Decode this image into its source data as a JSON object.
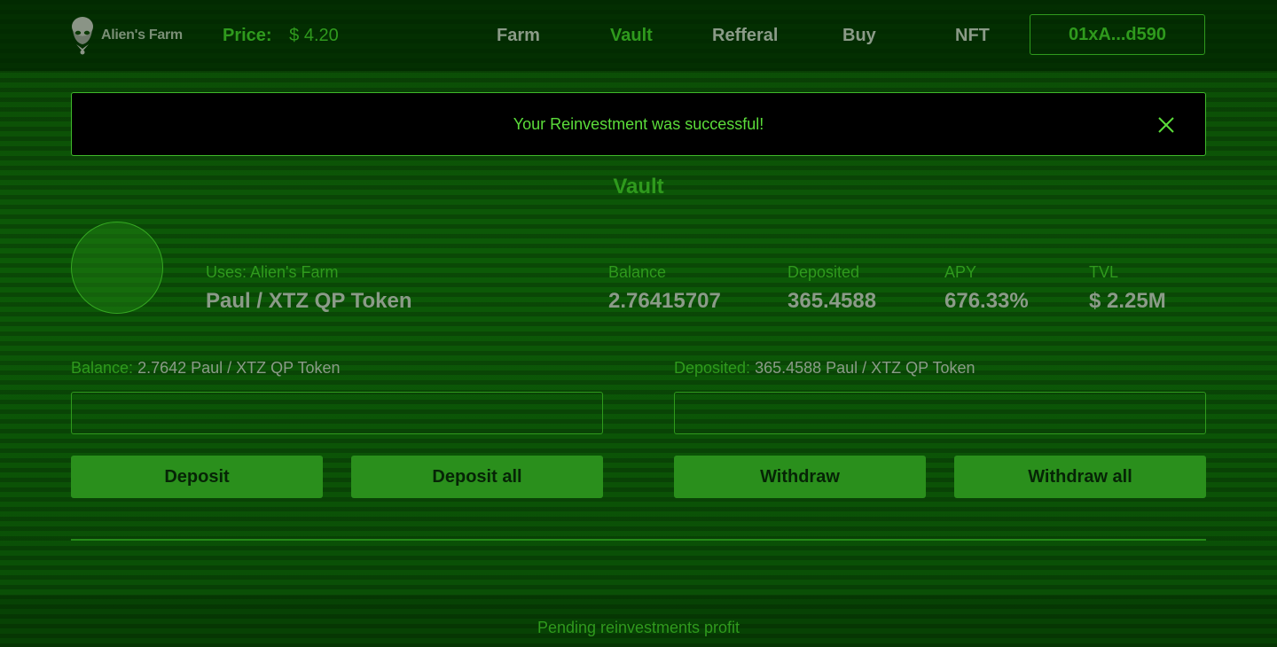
{
  "header": {
    "logo_text": "Alien's Farm",
    "price_label": "Price:",
    "price_value": "$ 4.20",
    "nav": [
      {
        "label": "Farm",
        "active": false
      },
      {
        "label": "Vault",
        "active": true
      },
      {
        "label": "Refferal",
        "active": false
      },
      {
        "label": "Buy",
        "active": false
      },
      {
        "label": "NFT",
        "active": false
      }
    ],
    "wallet_address": "01xA...d590"
  },
  "toast": {
    "message": "Your Reinvestment was successful!",
    "close_icon": "close-x-icon"
  },
  "page_title": "Vault",
  "pool": {
    "uses_label": "Uses: Alien's Farm",
    "name": "Paul / XTZ QP Token",
    "stats": [
      {
        "label": "Balance",
        "value": "2.76415707"
      },
      {
        "label": "Deposited",
        "value": "365.4588"
      },
      {
        "label": "APY",
        "value": "676.33%"
      },
      {
        "label": "TVL",
        "value": "$ 2.25M"
      }
    ]
  },
  "deposit": {
    "balance_label": "Balance:",
    "balance_value": "2.7642 Paul / XTZ QP Token",
    "input_value": "",
    "deposit_button": "Deposit",
    "deposit_all_button": "Deposit all"
  },
  "withdraw": {
    "deposited_label": "Deposited:",
    "deposited_value": "365.4588 Paul / XTZ QP Token",
    "input_value": "",
    "withdraw_button": "Withdraw",
    "withdraw_all_button": "Withdraw all"
  },
  "footer": {
    "pending_label": "Pending reinvestments profit"
  },
  "colors": {
    "accent_green": "#2f9a1d",
    "bright_green": "#5bdc3a",
    "muted_gray": "#8b9b88",
    "button_green": "#2a8f1c"
  }
}
